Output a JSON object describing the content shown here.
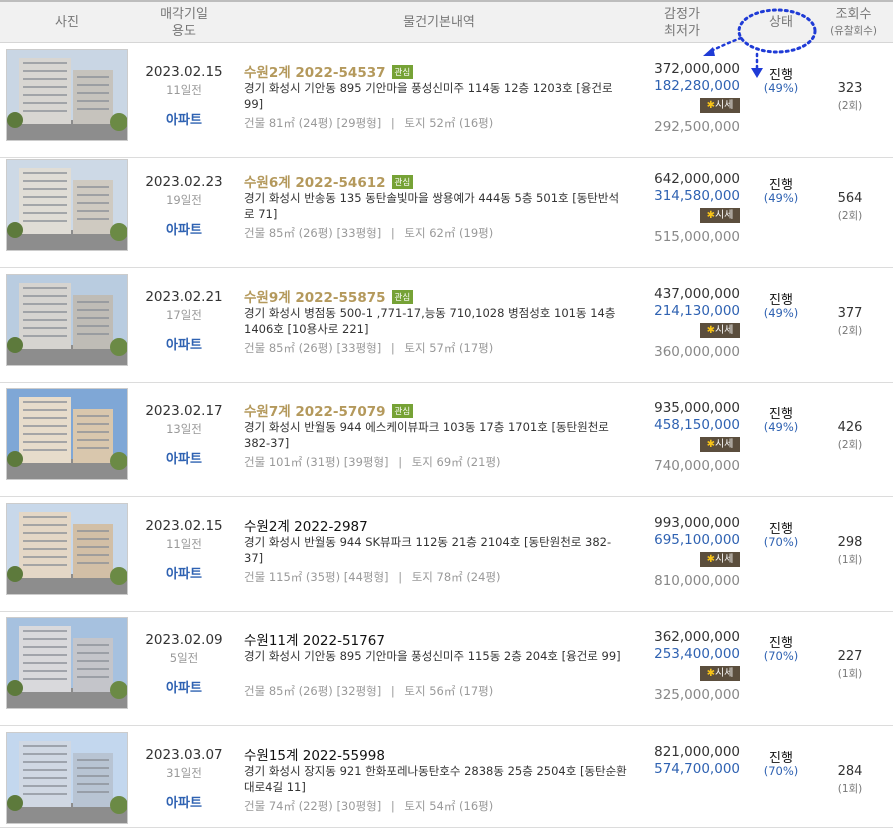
{
  "header": {
    "photo": "사진",
    "date_line1": "매각기일",
    "date_line2": "용도",
    "info": "물건기본내역",
    "price_line1": "감정가",
    "price_line2": "최저가",
    "status": "상태",
    "views_line1": "조회수",
    "views_line2": "(유찰회수)"
  },
  "labels": {
    "usage": "아파트",
    "badge": "관심",
    "sise": "시세",
    "sep": "|"
  },
  "rows": [
    {
      "date": "2023.02.15",
      "days": "11일전",
      "case": "수원2계 2022-54537",
      "interest": true,
      "addr": "경기 화성시 기안동 895 기안마을 풍성신미주 114동 12층 1203호 [융건로 99]",
      "bldg": "건물 81㎡ (24평) [29평형]",
      "land": "토지 52㎡ (16평)",
      "appraisal": "372,000,000",
      "min": "182,280,000",
      "market": "292,500,000",
      "status": "진행",
      "pct": "(49%)",
      "views": "323",
      "fail": "(2회)"
    },
    {
      "date": "2023.02.23",
      "days": "19일전",
      "case": "수원6계 2022-54612",
      "interest": true,
      "addr": "경기 화성시 반송동 135 동탄솔빛마을 쌍용예가 444동 5층 501호 [동탄반석로 71]",
      "bldg": "건물 85㎡ (26평) [33평형]",
      "land": "토지 62㎡ (19평)",
      "appraisal": "642,000,000",
      "min": "314,580,000",
      "market": "515,000,000",
      "status": "진행",
      "pct": "(49%)",
      "views": "564",
      "fail": "(2회)"
    },
    {
      "date": "2023.02.21",
      "days": "17일전",
      "case": "수원9계 2022-55875",
      "interest": true,
      "addr": "경기 화성시 병점동 500-1 ,771-17,능동 710,1028 병점성호 101동 14층 1406호 [10용사로 221]",
      "bldg": "건물 85㎡ (26평) [33평형]",
      "land": "토지 57㎡ (17평)",
      "appraisal": "437,000,000",
      "min": "214,130,000",
      "market": "360,000,000",
      "status": "진행",
      "pct": "(49%)",
      "views": "377",
      "fail": "(2회)"
    },
    {
      "date": "2023.02.17",
      "days": "13일전",
      "case": "수원7계 2022-57079",
      "interest": true,
      "addr": "경기 화성시 반월동 944 에스케이뷰파크 103동 17층 1701호 [동탄원천로 382-37]",
      "bldg": "건물 101㎡ (31평) [39평형]",
      "land": "토지 69㎡ (21평)",
      "appraisal": "935,000,000",
      "min": "458,150,000",
      "market": "740,000,000",
      "status": "진행",
      "pct": "(49%)",
      "views": "426",
      "fail": "(2회)"
    },
    {
      "date": "2023.02.15",
      "days": "11일전",
      "case": "수원2계 2022-2987",
      "interest": false,
      "addr": "경기 화성시 반월동 944 SK뷰파크 112동 21층 2104호 [동탄원천로 382-37]",
      "bldg": "건물 115㎡ (35평) [44평형]",
      "land": "토지 78㎡ (24평)",
      "appraisal": "993,000,000",
      "min": "695,100,000",
      "market": "810,000,000",
      "status": "진행",
      "pct": "(70%)",
      "views": "298",
      "fail": "(1회)"
    },
    {
      "date": "2023.02.09",
      "days": "5일전",
      "case": "수원11계 2022-51767",
      "interest": false,
      "addr": "경기 화성시 기안동 895 기안마을 풍성신미주 115동 2층 204호 [융건로 99]",
      "bldg": "건물 85㎡ (26평) [32평형]",
      "land": "토지 56㎡ (17평)",
      "appraisal": "362,000,000",
      "min": "253,400,000",
      "market": "325,000,000",
      "status": "진행",
      "pct": "(70%)",
      "views": "227",
      "fail": "(1회)"
    },
    {
      "date": "2023.03.07",
      "days": "31일전",
      "case": "수원15계 2022-55998",
      "interest": false,
      "addr": "경기 화성시 장지동 921 한화포레나동탄호수 2838동 25층 2504호 [동탄순환대로4길 11]",
      "bldg": "건물 74㎡ (22평) [30평형]",
      "land": "토지 54㎡ (16평)",
      "appraisal": "821,000,000",
      "min": "574,700,000",
      "market": "",
      "status": "진행",
      "pct": "(70%)",
      "views": "284",
      "fail": "(1회)"
    }
  ],
  "colors": {
    "link_blue": "#2f62b2",
    "case_gold": "#b4995c",
    "badge_green": "#76a236",
    "sise_brown": "#5b4e3d",
    "annotation_blue": "#1f3bd6"
  }
}
